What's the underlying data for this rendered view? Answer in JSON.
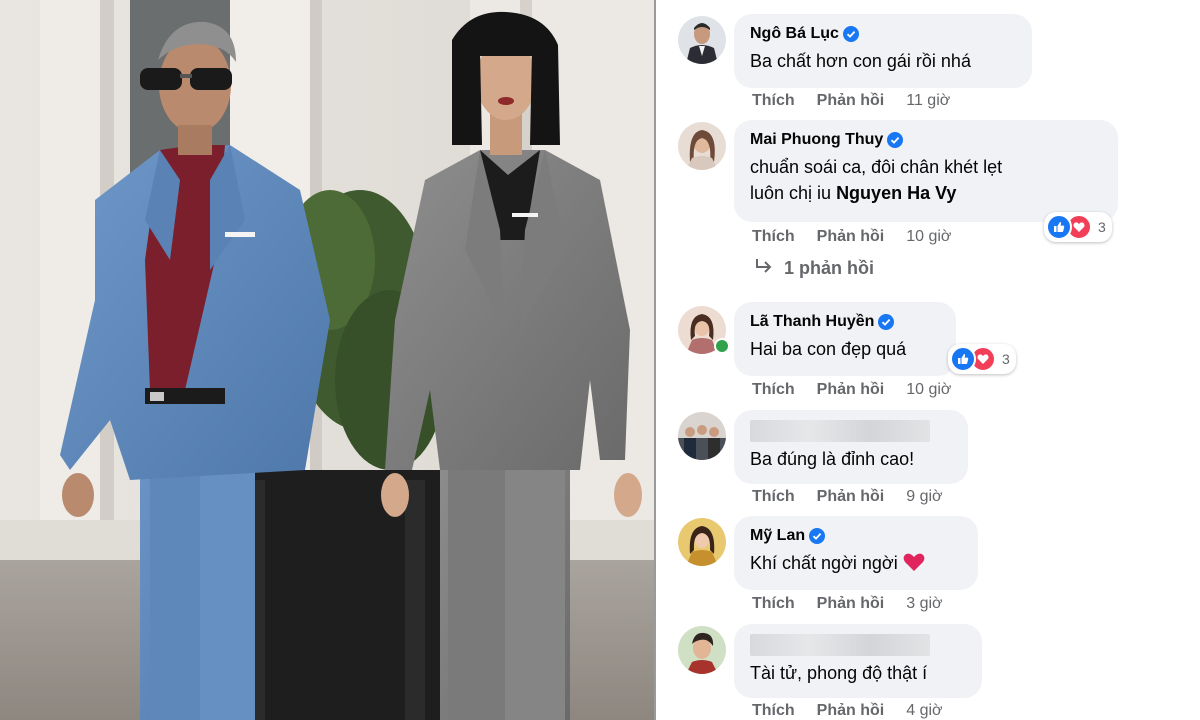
{
  "comments": [
    {
      "name": "Ngô Bá Lục",
      "text": "Ba chất hơn con gái rồi nhá",
      "like": "Thích",
      "reply": "Phản hồi",
      "time": "11 giờ"
    },
    {
      "name": "Mai Phuong Thuy",
      "text1": "chuẩn soái ca, đôi chân khét lẹt",
      "text2a": "luôn chị iu ",
      "mention": "Nguyen Ha Vy",
      "like": "Thích",
      "reply": "Phản hồi",
      "time": "10 giờ",
      "reactions": "3",
      "replies": "1 phản hồi"
    },
    {
      "name": "Lã Thanh Huyền",
      "text": "Hai ba con đẹp quá",
      "like": "Thích",
      "reply": "Phản hồi",
      "time": "10 giờ",
      "reactions": "3"
    },
    {
      "name": "",
      "text": "Ba đúng là đỉnh cao!",
      "like": "Thích",
      "reply": "Phản hồi",
      "time": "9 giờ"
    },
    {
      "name": "Mỹ Lan",
      "text": "Khí chất ngời ngời ",
      "like": "Thích",
      "reply": "Phản hồi",
      "time": "3 giờ"
    },
    {
      "name": "",
      "text": "Tài tử, phong độ thật í",
      "like": "Thích",
      "reply": "Phản hồi",
      "time": "4 giờ"
    }
  ],
  "colors": {
    "verified": "#1877f2",
    "like": "#1877f2",
    "love": "#f33e58",
    "bubble": "#f0f2f5",
    "meta": "#65676b"
  },
  "icons": [
    "verified-badge-icon",
    "like-reaction-icon",
    "love-reaction-icon",
    "reply-arrow-icon",
    "heart-emoji-icon"
  ]
}
